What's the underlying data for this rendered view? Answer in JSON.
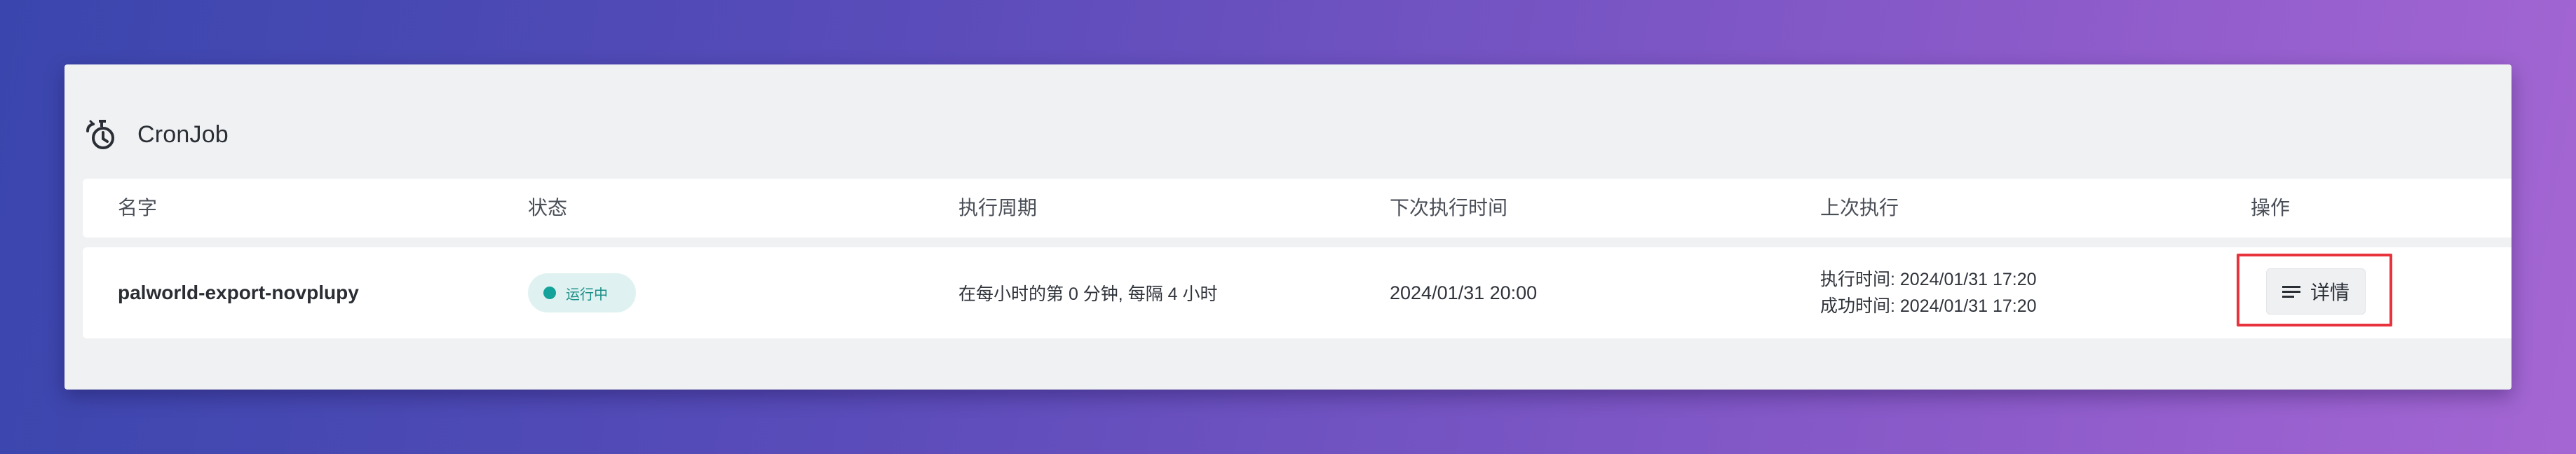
{
  "header": {
    "icon": "cronjob-icon",
    "title": "CronJob"
  },
  "table": {
    "columns": [
      "名字",
      "状态",
      "执行周期",
      "下次执行时间",
      "上次执行",
      "操作"
    ],
    "rows": [
      {
        "name": "palworld-export-novplupy",
        "status": {
          "label": "运行中",
          "color": "#14a39a"
        },
        "period": "在每小时的第 0 分钟, 每隔 4 小时",
        "next_run": "2024/01/31 20:00",
        "last_run": {
          "exec_time": "执行时间: 2024/01/31 17:20",
          "success_time": "成功时间: 2024/01/31 17:20"
        },
        "action": {
          "icon": "list-icon",
          "label": "详情"
        }
      }
    ]
  },
  "colors": {
    "highlight": "#e8323c",
    "badge_bg": "#dff2f1",
    "status_running": "#14a39a"
  }
}
